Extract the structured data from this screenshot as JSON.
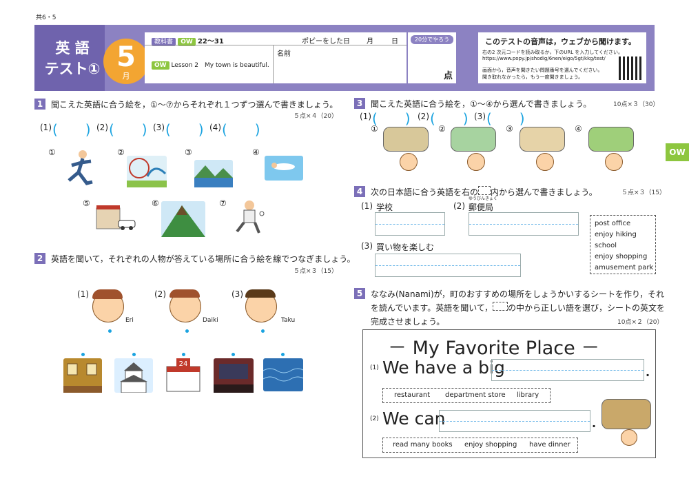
{
  "page_code": "共6・5",
  "header": {
    "title_line1": "英 語",
    "title_line2": "テスト①",
    "month_number": "5",
    "month_unit": "月",
    "textbook_tag": "教科書",
    "ow_tag": "OW",
    "pages": "22〜31",
    "date_label": "ポピーをした日",
    "month_label": "月",
    "day_label": "日",
    "lesson_tag": "OW",
    "lesson": "Lesson 2　My town is beautiful.",
    "name_label": "名前",
    "time_badge": "20分でやろう",
    "score_label": "点",
    "notice_title": "このテストの音声は，ウェブから聞けます。",
    "notice_line1": "右の2 次元コードを読み取るか，下のURL を入力してください。",
    "notice_url": "https://www.popy.jp/shodig/6nen/eigo/5gt/kkg/test/",
    "notice_line2": "画面から，音声を聞きたい問題番号を選んでください。",
    "notice_line3": "聞き取れなかったら，もう一度聞きましょう。"
  },
  "side_tab": "OW",
  "q1": {
    "num": "1",
    "text": "聞こえた英語に合う絵を，①〜⑦からそれぞれ１つずつ選んで書きましょう。",
    "points": "５点×４（20）",
    "answers": [
      "(1)",
      "(2)",
      "(3)",
      "(4)"
    ],
    "pictures": [
      "①",
      "②",
      "③",
      "④",
      "⑤",
      "⑥",
      "⑦"
    ]
  },
  "q2": {
    "num": "2",
    "text": "英語を聞いて，それぞれの人物が答えている場所に合う絵を線でつなぎましょう。",
    "points": "５点×３（15）",
    "people": [
      {
        "num": "(1)",
        "name": "Eri"
      },
      {
        "num": "(2)",
        "name": "Daiki"
      },
      {
        "num": "(3)",
        "name": "Taku"
      }
    ],
    "sign_24": "24"
  },
  "q3": {
    "num": "3",
    "text": "聞こえた英語に合う絵を，①〜④から選んで書きましょう。",
    "points": "10点×３（30）",
    "answers": [
      "(1)",
      "(2)",
      "(3)"
    ],
    "pictures": [
      "①",
      "②",
      "③",
      "④"
    ]
  },
  "q4": {
    "num": "4",
    "text_a": "次の日本語に合う英語を右の",
    "text_b": "内から選んで書きましょう。",
    "points": "５点×３（15）",
    "items": [
      {
        "num": "(1)",
        "jp": "学校"
      },
      {
        "num": "(2)",
        "jp": "郵便局",
        "ruby": "ゆうびんきょく"
      },
      {
        "num": "(3)",
        "jp": "買い物を楽しむ"
      }
    ],
    "choices": [
      "post office",
      "enjoy hiking",
      "school",
      "enjoy shopping",
      "amusement park"
    ]
  },
  "q5": {
    "num": "5",
    "line1": "ななみ(Nanami)が，町のおすすめの場所をしょうかいするシートを作り，それ",
    "line2a": "を読んでいます。英語を聞いて，",
    "line2b": "の中から正しい語を選び，シートの英文を",
    "line3": "完成させましょう。",
    "points": "10点×２（20）",
    "sheet_title": "－ My Favorite Place －",
    "s1_num": "(1)",
    "s1_text": "We have a big",
    "s1_choices": [
      "restaurant",
      "department store",
      "library"
    ],
    "s2_num": "(2)",
    "s2_text": "We can",
    "s2_choices": [
      "read many books",
      "enjoy shopping",
      "have dinner"
    ],
    "period": "."
  }
}
